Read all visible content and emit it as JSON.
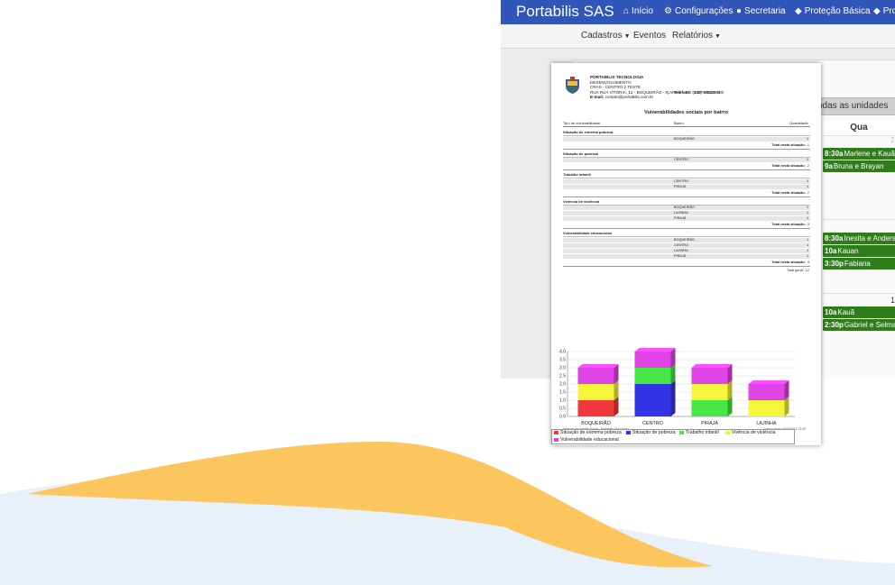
{
  "app": {
    "brand": "Portabilis SAS",
    "nav": [
      {
        "icon": "home-icon",
        "glyph": "⌂",
        "label": "Início"
      },
      {
        "icon": "gear-icon",
        "glyph": "⚙",
        "label": "Configurações"
      },
      {
        "icon": "user-icon",
        "glyph": "●",
        "label": "Secretaria"
      },
      {
        "icon": "shield-icon",
        "glyph": "◆",
        "label": "Proteção Básica"
      },
      {
        "icon": "shield-check-icon",
        "glyph": "◆",
        "label": "Pro"
      }
    ],
    "subnav": [
      {
        "label": "Cadastros",
        "dropdown": true
      },
      {
        "label": "Eventos",
        "dropdown": false
      },
      {
        "label": "Relatórios",
        "dropdown": true
      }
    ],
    "units_button": "odas as unidades",
    "day_header": "Qua",
    "faint_num": "2",
    "row_num": "1",
    "schedule": [
      {
        "time": "8:30a",
        "names": "Marlene e Kauã"
      },
      {
        "time": "9a",
        "names": "Bruna e Brayan"
      },
      {
        "time": "8:30a",
        "names": "Inesita e Anderson"
      },
      {
        "time": "10a",
        "names": "Kauan"
      },
      {
        "time": "3:30p",
        "names": "Fabiana"
      },
      {
        "time": "10a",
        "names": "Kauã"
      },
      {
        "time": "2:30p",
        "names": "Gabriel e Selma"
      }
    ]
  },
  "report": {
    "org": "PORTABILIS TECNOLOGIA",
    "dept": "DESENVOLVIMENTO",
    "unit": "CRAS - CENTRO 2 TESTE",
    "address": "RUA RUA VITÓRIA, 12 - BOQUEIRÃO - IÇARA 2 - SC - CEP 88820-000",
    "email_label": "E-mail:",
    "email": "contato@portabilis.com.br",
    "phone_label": "Telefone:",
    "phone": "(048) 30533001",
    "title": "Vulnerabilidades sociais por bairro",
    "col_type": "Tipo de vulnerabilidade",
    "col_bairro": "Bairro",
    "col_qty": "Quantidade",
    "total_label": "Total nesta situação:",
    "grand_total_label": "Total geral:",
    "grand_total": "12",
    "sections": [
      {
        "name": "Situação de extrema pobreza",
        "rows": [
          {
            "bairro": "BOQUEIRÃO",
            "qty": "1"
          }
        ],
        "total": "1"
      },
      {
        "name": "Situação de pobreza",
        "rows": [
          {
            "bairro": "CENTRO",
            "qty": "2"
          }
        ],
        "total": "2"
      },
      {
        "name": "Trabalho infantil",
        "rows": [
          {
            "bairro": "CENTRO",
            "qty": "1"
          },
          {
            "bairro": "PIRAJÁ",
            "qty": "1"
          }
        ],
        "total": "2"
      },
      {
        "name": "Vivência de violência",
        "rows": [
          {
            "bairro": "BOQUEIRÃO",
            "qty": "1"
          },
          {
            "bairro": "LAJINHA",
            "qty": "1"
          },
          {
            "bairro": "PIRAJÁ",
            "qty": "1"
          }
        ],
        "total": "3"
      },
      {
        "name": "Vulnerabilidade educacional",
        "rows": [
          {
            "bairro": "BOQUEIRÃO",
            "qty": "1"
          },
          {
            "bairro": "CENTRO",
            "qty": "1"
          },
          {
            "bairro": "LAJINHA",
            "qty": "1"
          },
          {
            "bairro": "PIRAJÁ",
            "qty": "1"
          }
        ],
        "total": "4"
      }
    ],
    "footer_left": "Sistema de Gestão Social - Portabilis Tecnologia",
    "footer_right": "Data e hora: 06/05/2016 23:25"
  },
  "colors": {
    "navbar": "#2f56b8",
    "schedule_green": "#2e7d1a",
    "wave_orange": "#fcc65e",
    "wave_blue": "#e8f0fa"
  },
  "chart_data": {
    "type": "bar",
    "stacked": true,
    "categories": [
      "BOQUEIRÃO",
      "CENTRO",
      "PIRAJÁ",
      "LAJINHA"
    ],
    "series": [
      {
        "name": "Situação de extrema pobreza",
        "color": "#f0393c",
        "values": [
          1,
          0,
          0,
          0
        ]
      },
      {
        "name": "Situação de pobreza",
        "color": "#3434e6",
        "values": [
          0,
          2,
          0,
          0
        ]
      },
      {
        "name": "Trabalho infantil",
        "color": "#46e646",
        "values": [
          0,
          1,
          1,
          0
        ]
      },
      {
        "name": "Vivência de violência",
        "color": "#f5f53c",
        "values": [
          1,
          0,
          1,
          1
        ]
      },
      {
        "name": "Vulnerabilidade educacional",
        "color": "#e043e6",
        "values": [
          1,
          1,
          1,
          1
        ]
      }
    ],
    "ylim": [
      0,
      4.0
    ],
    "yticks": [
      "0.0",
      "0.5",
      "1.0",
      "1.5",
      "2.0",
      "2.5",
      "3.0",
      "3.5",
      "4.0"
    ],
    "grid": true,
    "legend_position": "bottom"
  }
}
